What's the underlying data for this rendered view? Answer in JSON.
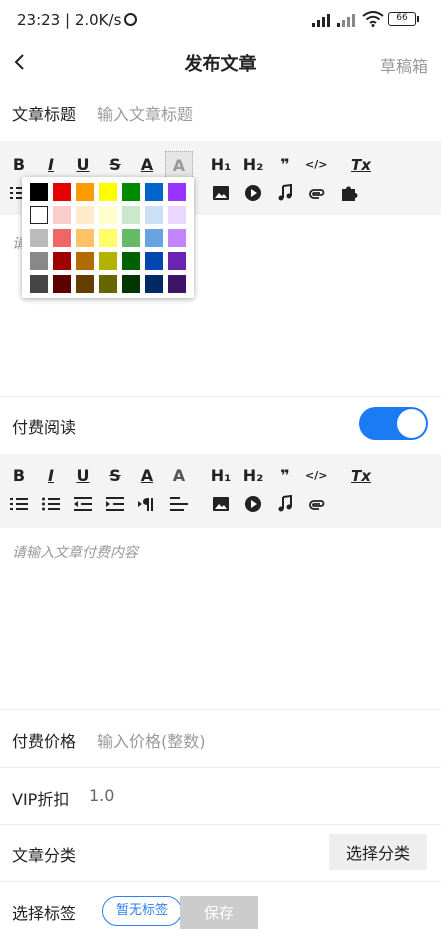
{
  "status_bar": {
    "time_speed": "23:23 | 2.0K/s",
    "battery": "66"
  },
  "header": {
    "title": "发布文章",
    "drafts": "草稿箱"
  },
  "title_row": {
    "label": "文章标题",
    "placeholder": "输入文章标题"
  },
  "toolbar": {
    "bold": "B",
    "italic": "I",
    "underline": "U",
    "strike": "S",
    "font_color": "A",
    "bg_color": "A",
    "h1": "H₁",
    "h2": "H₂",
    "quote": "❞",
    "code": "</>",
    "clear_format": "Tx"
  },
  "editor": {
    "hint_fragment": "请",
    "paid_placeholder": "请输入文章付费内容"
  },
  "palette": {
    "rows": [
      [
        "#000000",
        "#e60000",
        "#ff9900",
        "#ffff00",
        "#008a00",
        "#0066cc",
        "#9933ff"
      ],
      [
        "#ffffff",
        "#facccc",
        "#ffebcc",
        "#ffffcc",
        "#cce8cc",
        "#cce0f5",
        "#ebd6ff"
      ],
      [
        "#bbbbbb",
        "#f06666",
        "#ffc266",
        "#ffff66",
        "#66b966",
        "#66a3e0",
        "#c285ff"
      ],
      [
        "#888888",
        "#a10000",
        "#b26b00",
        "#b2b200",
        "#006100",
        "#0047b2",
        "#6b24b2"
      ],
      [
        "#444444",
        "#5c0000",
        "#663d00",
        "#666600",
        "#003700",
        "#002966",
        "#3d1466"
      ]
    ]
  },
  "paid_reading": {
    "label": "付费阅读",
    "enabled": true,
    "accent": "#1a7bf2"
  },
  "price_row": {
    "label": "付费价格",
    "placeholder": "输入价格(整数)"
  },
  "vip_row": {
    "label": "VIP折扣",
    "value": "1.0"
  },
  "category_row": {
    "label": "文章分类",
    "button": "选择分类"
  },
  "tag_row": {
    "label": "选择标签",
    "tag": "暂无标签",
    "save": "保存"
  }
}
